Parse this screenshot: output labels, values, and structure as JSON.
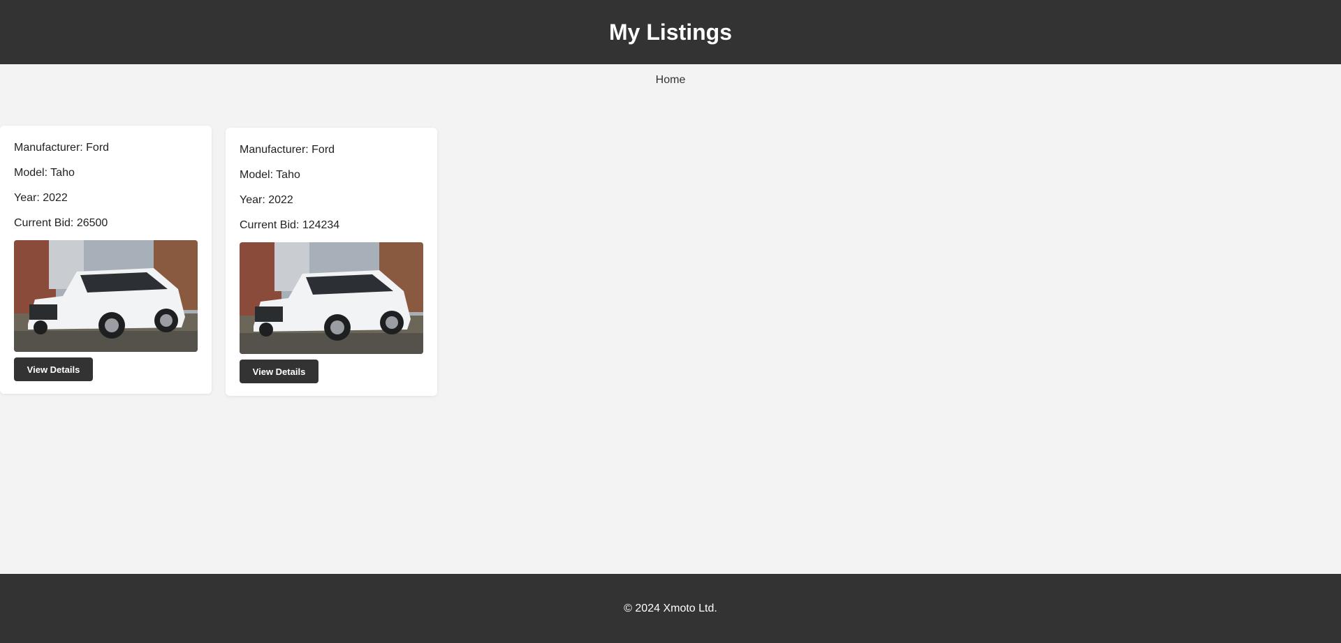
{
  "header": {
    "title": "My Listings"
  },
  "nav": {
    "home_label": "Home"
  },
  "listings": [
    {
      "manufacturer": "Manufacturer: Ford",
      "model": "Model: Taho",
      "year": "Year: 2022",
      "current_bid": "Current Bid: 26500",
      "button_label": "View Details"
    },
    {
      "manufacturer": "Manufacturer: Ford",
      "model": "Model: Taho",
      "year": "Year: 2022",
      "current_bid": "Current Bid: 124234",
      "button_label": "View Details"
    }
  ],
  "footer": {
    "text": "© 2024 Xmoto Ltd."
  },
  "colors": {
    "header_bg": "#333333",
    "page_bg": "#f3f3f3",
    "button_bg": "#333333"
  }
}
